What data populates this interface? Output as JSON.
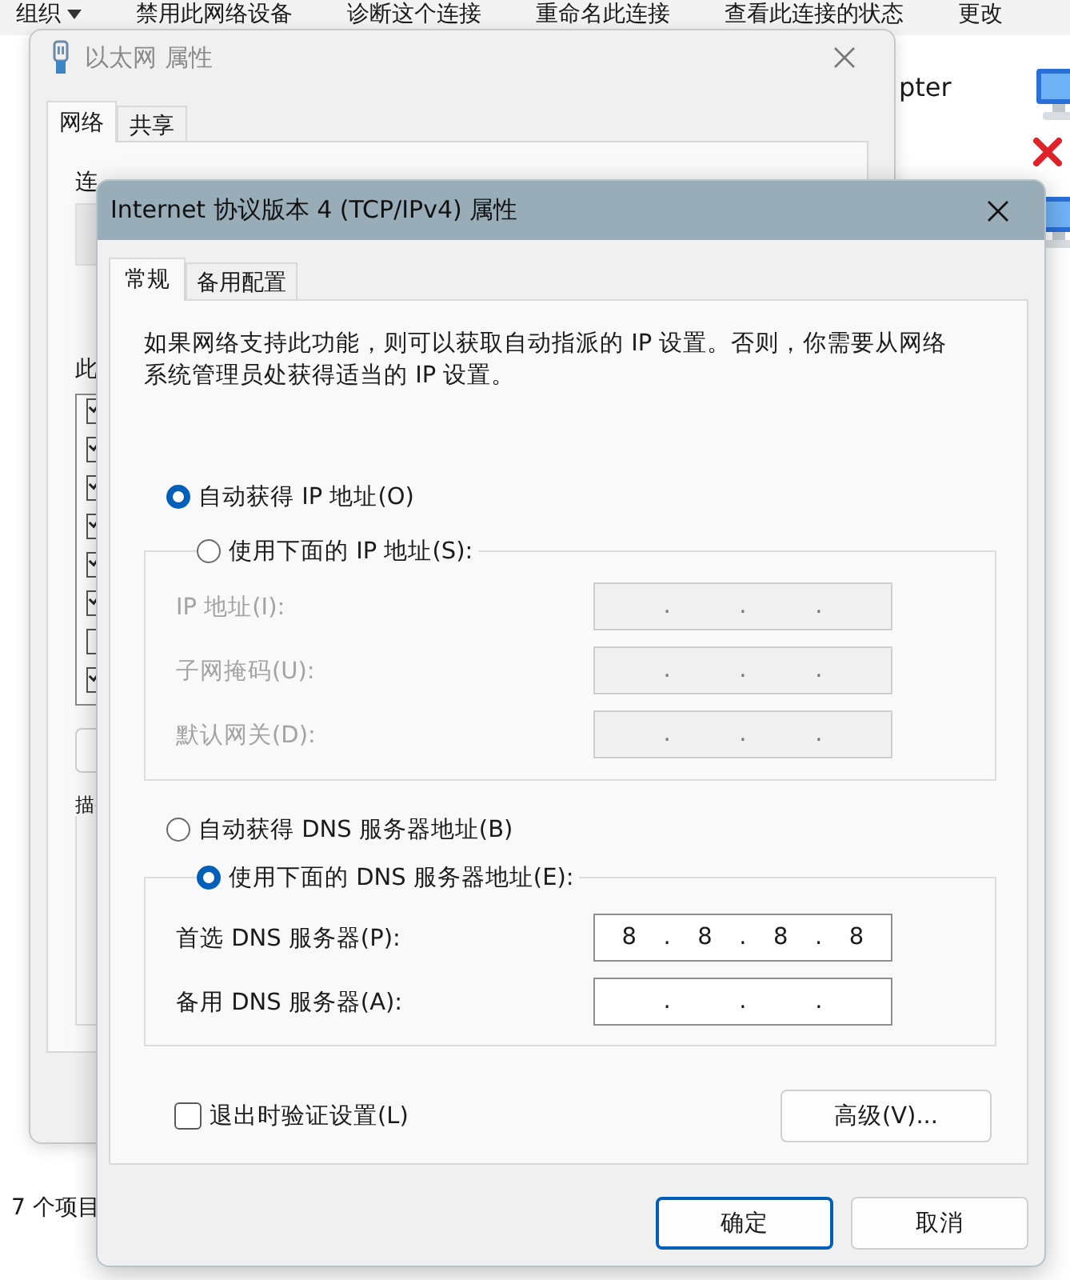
{
  "explorer": {
    "toolbar": [
      {
        "label": "组织",
        "menu": true
      },
      {
        "label": "禁用此网络设备",
        "menu": false
      },
      {
        "label": "诊断这个连接",
        "menu": false
      },
      {
        "label": "重命名此连接",
        "menu": false
      },
      {
        "label": "查看此连接的状态",
        "menu": false
      },
      {
        "label": "更改",
        "menu": false
      }
    ],
    "adapter_name": "pter",
    "adapters": [
      {
        "disconnected": true
      },
      {
        "disconnected": false
      }
    ],
    "status_bar": "7 个项目"
  },
  "ethernet_window": {
    "title": "以太网 属性",
    "tabs": [
      {
        "label": "网络",
        "selected": true
      },
      {
        "label": "共享",
        "selected": false
      }
    ],
    "labels": [
      "连",
      "此",
      "描"
    ],
    "components": [
      {
        "checked": true
      },
      {
        "checked": true
      },
      {
        "checked": true
      },
      {
        "checked": true
      },
      {
        "checked": true
      },
      {
        "checked": true
      },
      {
        "checked": false
      },
      {
        "checked": true
      }
    ]
  },
  "tcpip_dialog": {
    "title": "Internet 协议版本 4 (TCP/IPv4) 属性",
    "tabs": [
      {
        "label": "常规",
        "selected": true
      },
      {
        "label": "备用配置",
        "selected": false
      }
    ],
    "description": "如果网络支持此功能，则可以获取自动指派的 IP 设置。否则，你需要从网络系统管理员处获得适当的 IP 设置。",
    "ip_options": [
      {
        "label": "自动获得 IP 地址(O)",
        "selected": true
      },
      {
        "label": "使用下面的 IP 地址(S):",
        "selected": false
      }
    ],
    "ip_fields": {
      "disabled": true,
      "items": [
        {
          "label": "IP 地址(I):",
          "parts": [
            ".",
            ".",
            "."
          ]
        },
        {
          "label": "子网掩码(U):",
          "parts": [
            ".",
            ".",
            "."
          ]
        },
        {
          "label": "默认网关(D):",
          "parts": [
            ".",
            ".",
            "."
          ]
        }
      ]
    },
    "dns_options": [
      {
        "label": "自动获得 DNS 服务器地址(B)",
        "selected": false
      },
      {
        "label": "使用下面的 DNS 服务器地址(E):",
        "selected": true
      }
    ],
    "dns_fields": {
      "disabled": false,
      "items": [
        {
          "label": "首选 DNS 服务器(P):",
          "parts": [
            "8",
            ".",
            "8",
            ".",
            "8",
            ".",
            "8"
          ]
        },
        {
          "label": "备用 DNS 服务器(A):",
          "parts": [
            ".",
            ".",
            "."
          ]
        }
      ]
    },
    "validate_on_exit": {
      "label": "退出时验证设置(L)",
      "checked": false
    },
    "buttons": [
      {
        "label": "高级(V)...",
        "kind": "advanced"
      },
      {
        "label": "确定",
        "kind": "default"
      },
      {
        "label": "取消",
        "kind": "normal"
      }
    ]
  }
}
